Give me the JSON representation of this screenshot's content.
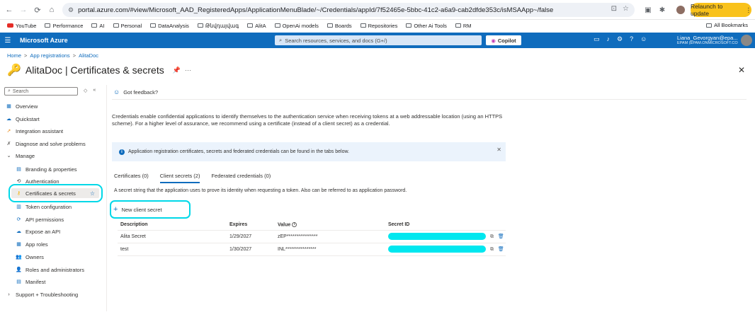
{
  "browser": {
    "url": "portal.azure.com/#view/Microsoft_AAD_RegisteredApps/ApplicationMenuBlade/~/Credentials/appId/7f52465e-5bbc-41c2-a6a9-cab2dfde353c/isMSAApp~/false",
    "relaunch_label": "Relaunch to update"
  },
  "bookmarks": [
    {
      "label": "YouTube",
      "icon": "youtube-icon"
    },
    {
      "label": "Performance",
      "icon": "folder-icon"
    },
    {
      "label": "AI",
      "icon": "folder-icon"
    },
    {
      "label": "Personal",
      "icon": "folder-icon"
    },
    {
      "label": "DataAnalysis",
      "icon": "folder-icon"
    },
    {
      "label": "Թնվդայվագ",
      "icon": "folder-icon"
    },
    {
      "label": "AlitA",
      "icon": "folder-icon"
    },
    {
      "label": "OpenAi models",
      "icon": "folder-icon"
    },
    {
      "label": "Boards",
      "icon": "folder-icon"
    },
    {
      "label": "Repositories",
      "icon": "folder-icon"
    },
    {
      "label": "Other Ai Tools",
      "icon": "folder-icon"
    },
    {
      "label": "RM",
      "icon": "folder-icon"
    }
  ],
  "all_bookmarks_label": "All Bookmarks",
  "azure_header": {
    "brand": "Microsoft Azure",
    "search_placeholder": "Search resources, services, and docs (G+/)",
    "copilot_label": "Copilot",
    "user_name": "Liana_Gevorgyan@epa...",
    "user_org": "EPAM (EPAM.ONMICROSOFT.CO..."
  },
  "breadcrumb": {
    "home": "Home",
    "sep": ">",
    "app_registrations": "App registrations",
    "app": "AlitaDoc"
  },
  "page_title": "AlitaDoc | Certificates & secrets",
  "sidebar": {
    "search_placeholder": "Search",
    "items": [
      {
        "label": "Overview",
        "icon": "overview-icon"
      },
      {
        "label": "Quickstart",
        "icon": "cloud-icon"
      },
      {
        "label": "Integration assistant",
        "icon": "rocket-icon"
      },
      {
        "label": "Diagnose and solve problems",
        "icon": "wrench-icon"
      },
      {
        "label": "Manage",
        "icon": "chevron-down-icon"
      },
      {
        "label": "Branding & properties",
        "icon": "branding-icon"
      },
      {
        "label": "Authentication",
        "icon": "authentication-icon"
      },
      {
        "label": "Certificates & secrets",
        "icon": "key-icon"
      },
      {
        "label": "Token configuration",
        "icon": "token-icon"
      },
      {
        "label": "API permissions",
        "icon": "api-permissions-icon"
      },
      {
        "label": "Expose an API",
        "icon": "cloud-icon"
      },
      {
        "label": "App roles",
        "icon": "app-roles-icon"
      },
      {
        "label": "Owners",
        "icon": "owners-icon"
      },
      {
        "label": "Roles and administrators",
        "icon": "roles-icon"
      },
      {
        "label": "Manifest",
        "icon": "manifest-icon"
      },
      {
        "label": "Support + Troubleshooting",
        "icon": "chevron-right-icon"
      }
    ]
  },
  "content": {
    "feedback_label": "Got feedback?",
    "description": "Credentials enable confidential applications to identify themselves to the authentication service when receiving tokens at a web addressable location (using an HTTPS scheme). For a higher level of assurance, we recommend using a certificate (instead of a client secret) as a credential.",
    "info_text": "Application registration certificates, secrets and federated credentials can be found in the tabs below.",
    "tabs": [
      {
        "label": "Certificates (0)"
      },
      {
        "label": "Client secrets (2)"
      },
      {
        "label": "Federated credentials (0)"
      }
    ],
    "tab_description": "A secret string that the application uses to prove its identity when requesting a token. Also can be referred to as application password.",
    "new_secret_label": "New client secret",
    "table": {
      "headers": [
        "Description",
        "Expires",
        "Value",
        "Secret ID"
      ],
      "rows": [
        {
          "description": "Alita Secret",
          "expires": "1/29/2027",
          "value": "zEP****************"
        },
        {
          "description": "test",
          "expires": "1/30/2027",
          "value": "INL****************"
        }
      ]
    }
  },
  "colors": {
    "azure_blue": "#0f6cbd",
    "highlight": "#00d8e8",
    "relaunch": "#f9c21b"
  }
}
